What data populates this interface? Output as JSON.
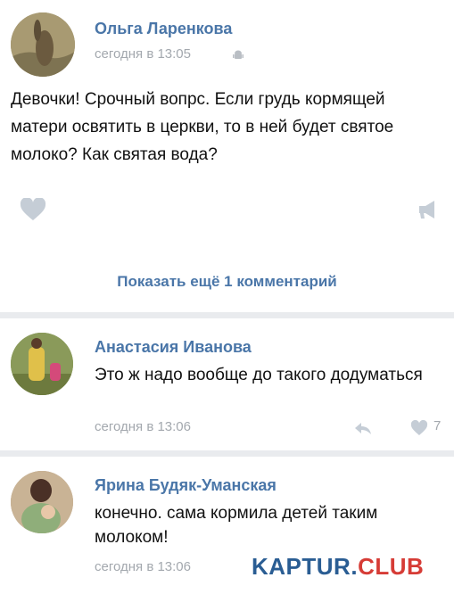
{
  "post": {
    "author": "Ольга Ларенкова",
    "time": "сегодня в 13:05",
    "text": "Девочки! Срочный вопрс. Если грудь кормящей матери освятить в церкви, то в ней будет святое молоко? Как святая вода?",
    "more_comments_label": "Показать ещё 1 комментарий"
  },
  "comments": [
    {
      "author": "Анастасия Иванова",
      "text": "Это ж надо вообще до такого додуматься",
      "time": "сегодня в 13:06",
      "likes": "7"
    },
    {
      "author": "Ярина Будяк-Уманская",
      "text": "конечно. сама кормила детей таким молоком!",
      "time": "сегодня в 13:06"
    }
  ],
  "watermark": {
    "brand": "KAPTUR",
    "dot": ".",
    "suffix": "CLUB"
  },
  "icons": {
    "android": "android-icon",
    "like": "heart-icon",
    "share": "megaphone-icon",
    "reply": "reply-arrow-icon"
  },
  "colors": {
    "link": "#4a76a8",
    "meta": "#a3a8ae",
    "text": "#111111",
    "background": "#e9ebee"
  }
}
